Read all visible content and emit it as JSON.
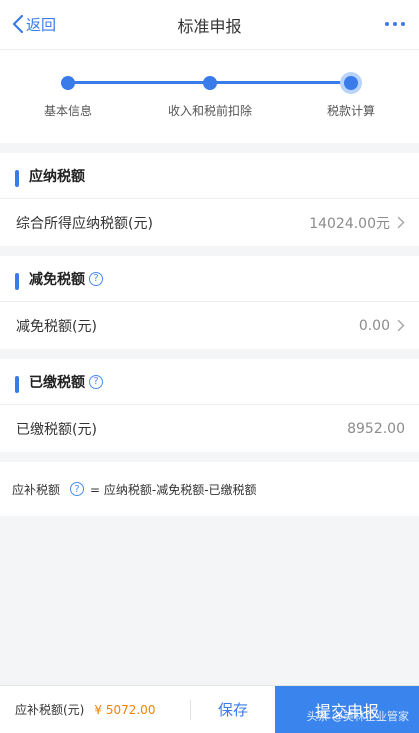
{
  "header": {
    "back_label": "返回",
    "title": "标准申报"
  },
  "steps": [
    {
      "label": "基本信息"
    },
    {
      "label": "收入和税前扣除"
    },
    {
      "label": "税款计算"
    }
  ],
  "sections": {
    "payable": {
      "title": "应纳税额",
      "row_label": "综合所得应纳税额(元)",
      "row_value": "14024.00元"
    },
    "reduction": {
      "title": "减免税额",
      "row_label": "减免税额(元)",
      "row_value": "0.00"
    },
    "paid": {
      "title": "已缴税额",
      "row_label": "已缴税额(元)",
      "row_value": "8952.00"
    }
  },
  "formula": {
    "label": "应补税额",
    "expression": "= 应纳税额-减免税额-已缴税额"
  },
  "footer": {
    "due_label": "应补税额(元)",
    "due_amount": "¥ 5072.00",
    "save_label": "保存",
    "submit_label": "提交申报",
    "watermark": "头条 @美林企业管家"
  },
  "icons": {
    "back": "chevron-left-icon",
    "more": "more-dots-icon",
    "help": "question-circle-icon",
    "chevron": "chevron-right-icon"
  },
  "colors": {
    "accent": "#3a7bea",
    "amount": "#f08300"
  }
}
